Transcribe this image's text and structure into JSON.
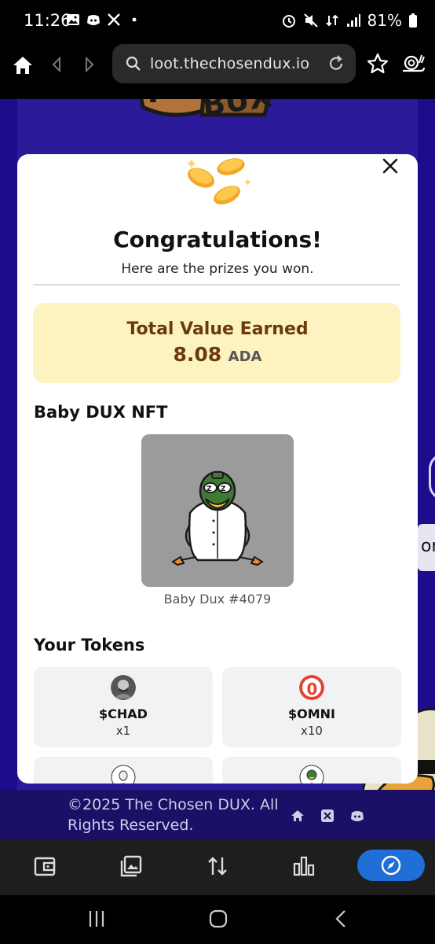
{
  "status_bar": {
    "time": "11:26",
    "battery": "81%"
  },
  "browser": {
    "url": "loot.thechosendux.io"
  },
  "modal": {
    "title": "Congratulations!",
    "subtitle": "Here are the prizes you won.",
    "total_label": "Total Value Earned",
    "total_value": "8.08",
    "total_unit": "ADA",
    "nft_section_title": "Baby DUX NFT",
    "nft_caption": "Baby Dux #4079",
    "tokens_section_title": "Your Tokens",
    "tokens": [
      {
        "name": "$CHAD",
        "qty": "x1"
      },
      {
        "name": "$OMNI",
        "qty": "x10"
      },
      {
        "name": "",
        "qty": ""
      },
      {
        "name": "",
        "qty": ""
      }
    ]
  },
  "footer": {
    "copyright": "©2025 The Chosen DUX. All Rights Reserved."
  },
  "side_tab": {
    "text": "on"
  },
  "colors": {
    "page_bg": "#1d0c8c",
    "value_card_bg": "#fdf3c0",
    "value_text": "#6b3a0a",
    "active_tab": "#1f6fd6"
  }
}
